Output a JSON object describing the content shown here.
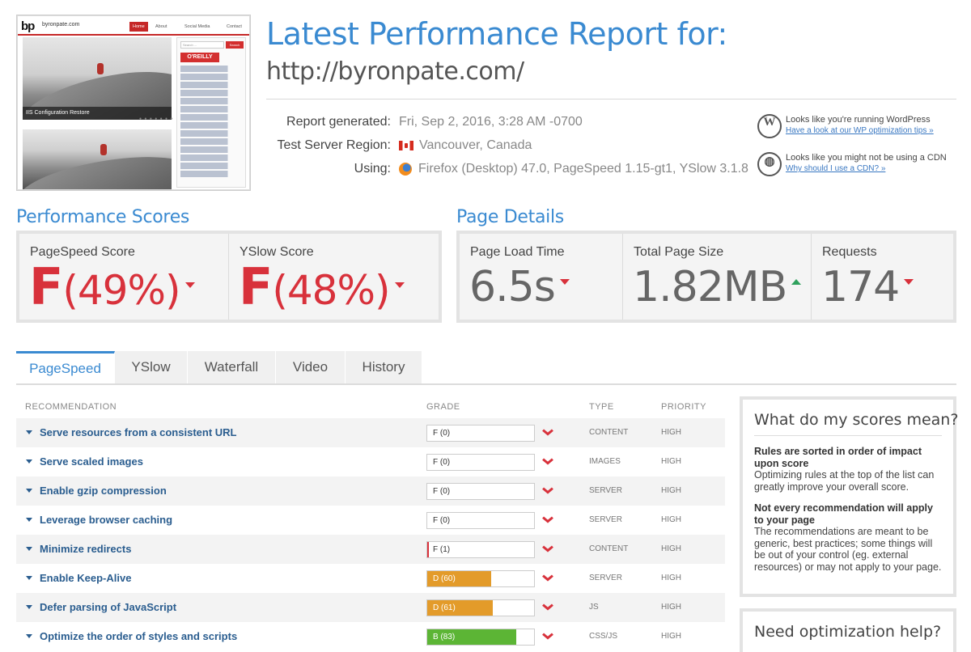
{
  "thumbnail": {
    "logo": "bp",
    "site": "byronpate.com",
    "nav": [
      "Home",
      "About",
      "Social Media",
      "Contact"
    ],
    "search_placeholder": "Search ...",
    "search_button": "Search",
    "sidebar_brand": "O'REILLY",
    "slide_caption": "IIS Configuration Restore"
  },
  "header": {
    "title": "Latest Performance Report for:",
    "url": "http://byronpate.com/"
  },
  "meta": {
    "generated_label": "Report generated:",
    "generated_value": "Fri, Sep 2, 2016, 3:28 AM -0700",
    "region_label": "Test Server Region:",
    "region_value": "Vancouver, Canada",
    "using_label": "Using:",
    "using_value": "Firefox (Desktop) 47.0, PageSpeed 1.15-gt1, YSlow 3.1.8"
  },
  "notices": [
    {
      "icon": "wordpress-icon",
      "text": "Looks like you're running WordPress",
      "link": "Have a look at our WP optimization tips »"
    },
    {
      "icon": "globe-icon",
      "text": "Looks like you might not be using a CDN",
      "link": "Why should I use a CDN? »"
    }
  ],
  "performance": {
    "title": "Performance Scores",
    "pagespeed_label": "PageSpeed Score",
    "pagespeed_grade": "F",
    "pagespeed_pct": "(49%)",
    "yslow_label": "YSlow Score",
    "yslow_grade": "F",
    "yslow_pct": "(48%)"
  },
  "details": {
    "title": "Page Details",
    "load_label": "Page Load Time",
    "load_value": "6.5s",
    "size_label": "Total Page Size",
    "size_value": "1.82MB",
    "req_label": "Requests",
    "req_value": "174"
  },
  "tabs": [
    "PageSpeed",
    "YSlow",
    "Waterfall",
    "Video",
    "History"
  ],
  "table": {
    "headers": {
      "recommendation": "RECOMMENDATION",
      "grade": "GRADE",
      "type": "TYPE",
      "priority": "PRIORITY"
    },
    "rows": [
      {
        "name": "Serve resources from a consistent URL",
        "grade": "F (0)",
        "score": 0,
        "type": "CONTENT",
        "priority": "HIGH"
      },
      {
        "name": "Serve scaled images",
        "grade": "F (0)",
        "score": 0,
        "type": "IMAGES",
        "priority": "HIGH"
      },
      {
        "name": "Enable gzip compression",
        "grade": "F (0)",
        "score": 0,
        "type": "SERVER",
        "priority": "HIGH"
      },
      {
        "name": "Leverage browser caching",
        "grade": "F (0)",
        "score": 0,
        "type": "SERVER",
        "priority": "HIGH"
      },
      {
        "name": "Minimize redirects",
        "grade": "F (1)",
        "score": 1,
        "type": "CONTENT",
        "priority": "HIGH"
      },
      {
        "name": "Enable Keep-Alive",
        "grade": "D (60)",
        "score": 60,
        "type": "SERVER",
        "priority": "HIGH"
      },
      {
        "name": "Defer parsing of JavaScript",
        "grade": "D (61)",
        "score": 61,
        "type": "JS",
        "priority": "HIGH"
      },
      {
        "name": "Optimize the order of styles and scripts",
        "grade": "B (83)",
        "score": 83,
        "type": "CSS/JS",
        "priority": "HIGH"
      }
    ]
  },
  "colors": {
    "accent": "#3a8ad1",
    "bad": "#d8313b",
    "good": "#2fa15d",
    "grade_f": "#d8313b",
    "grade_d": "#e39b2a",
    "grade_b": "#5cb535"
  },
  "side": {
    "title": "What do my scores mean?",
    "p1_title": "Rules are sorted in order of impact upon score",
    "p1_body": "Optimizing rules at the top of the list can greatly improve your overall score.",
    "p2_title": "Not every recommendation will apply to your page",
    "p2_body": "The recommendations are meant to be generic, best practices; some things will be out of your control (eg. external resources) or may not apply to your page.",
    "help_title": "Need optimization help?"
  }
}
